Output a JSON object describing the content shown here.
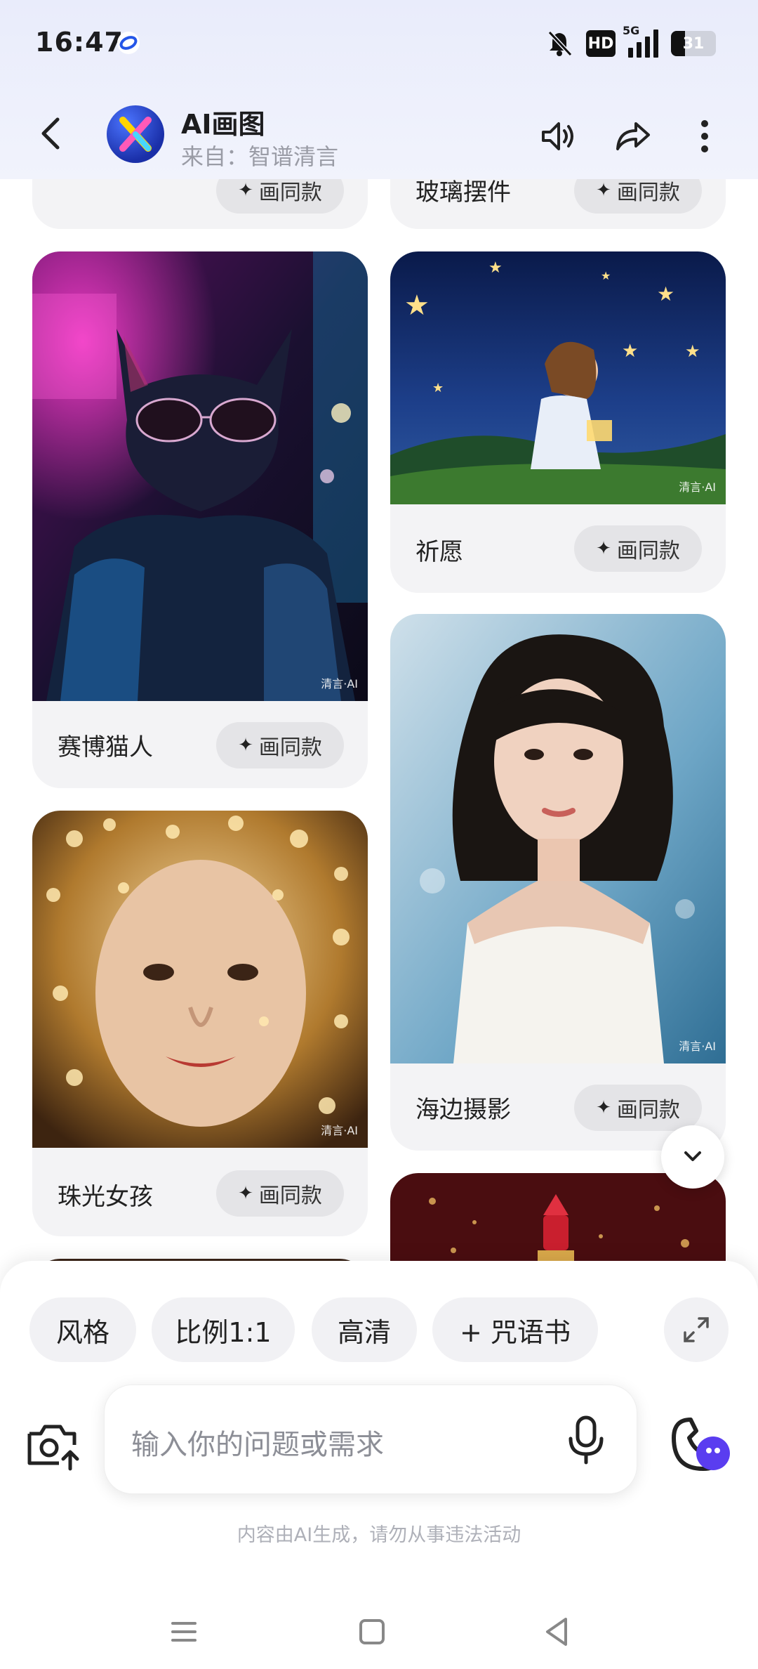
{
  "status_bar": {
    "time": "16:47",
    "hd_label": "HD",
    "network_label": "5G",
    "battery": "31"
  },
  "header": {
    "title": "AI画图",
    "subtitle": "来自：智谱清言"
  },
  "feed": {
    "same_style_label": "画同款",
    "watermark": "清言·AI",
    "cards": [
      {
        "caption": ""
      },
      {
        "caption": "玻璃摆件"
      },
      {
        "caption": "赛博猫人"
      },
      {
        "caption": "祈愿"
      },
      {
        "caption": "海边摄影"
      },
      {
        "caption": "珠光女孩"
      },
      {
        "caption": ""
      }
    ]
  },
  "toolbar": {
    "chips": [
      "风格",
      "比例1:1",
      "高清",
      "+ 咒语书"
    ]
  },
  "input": {
    "placeholder": "输入你的问题或需求"
  },
  "disclaimer": "内容由AI生成，请勿从事违法活动"
}
